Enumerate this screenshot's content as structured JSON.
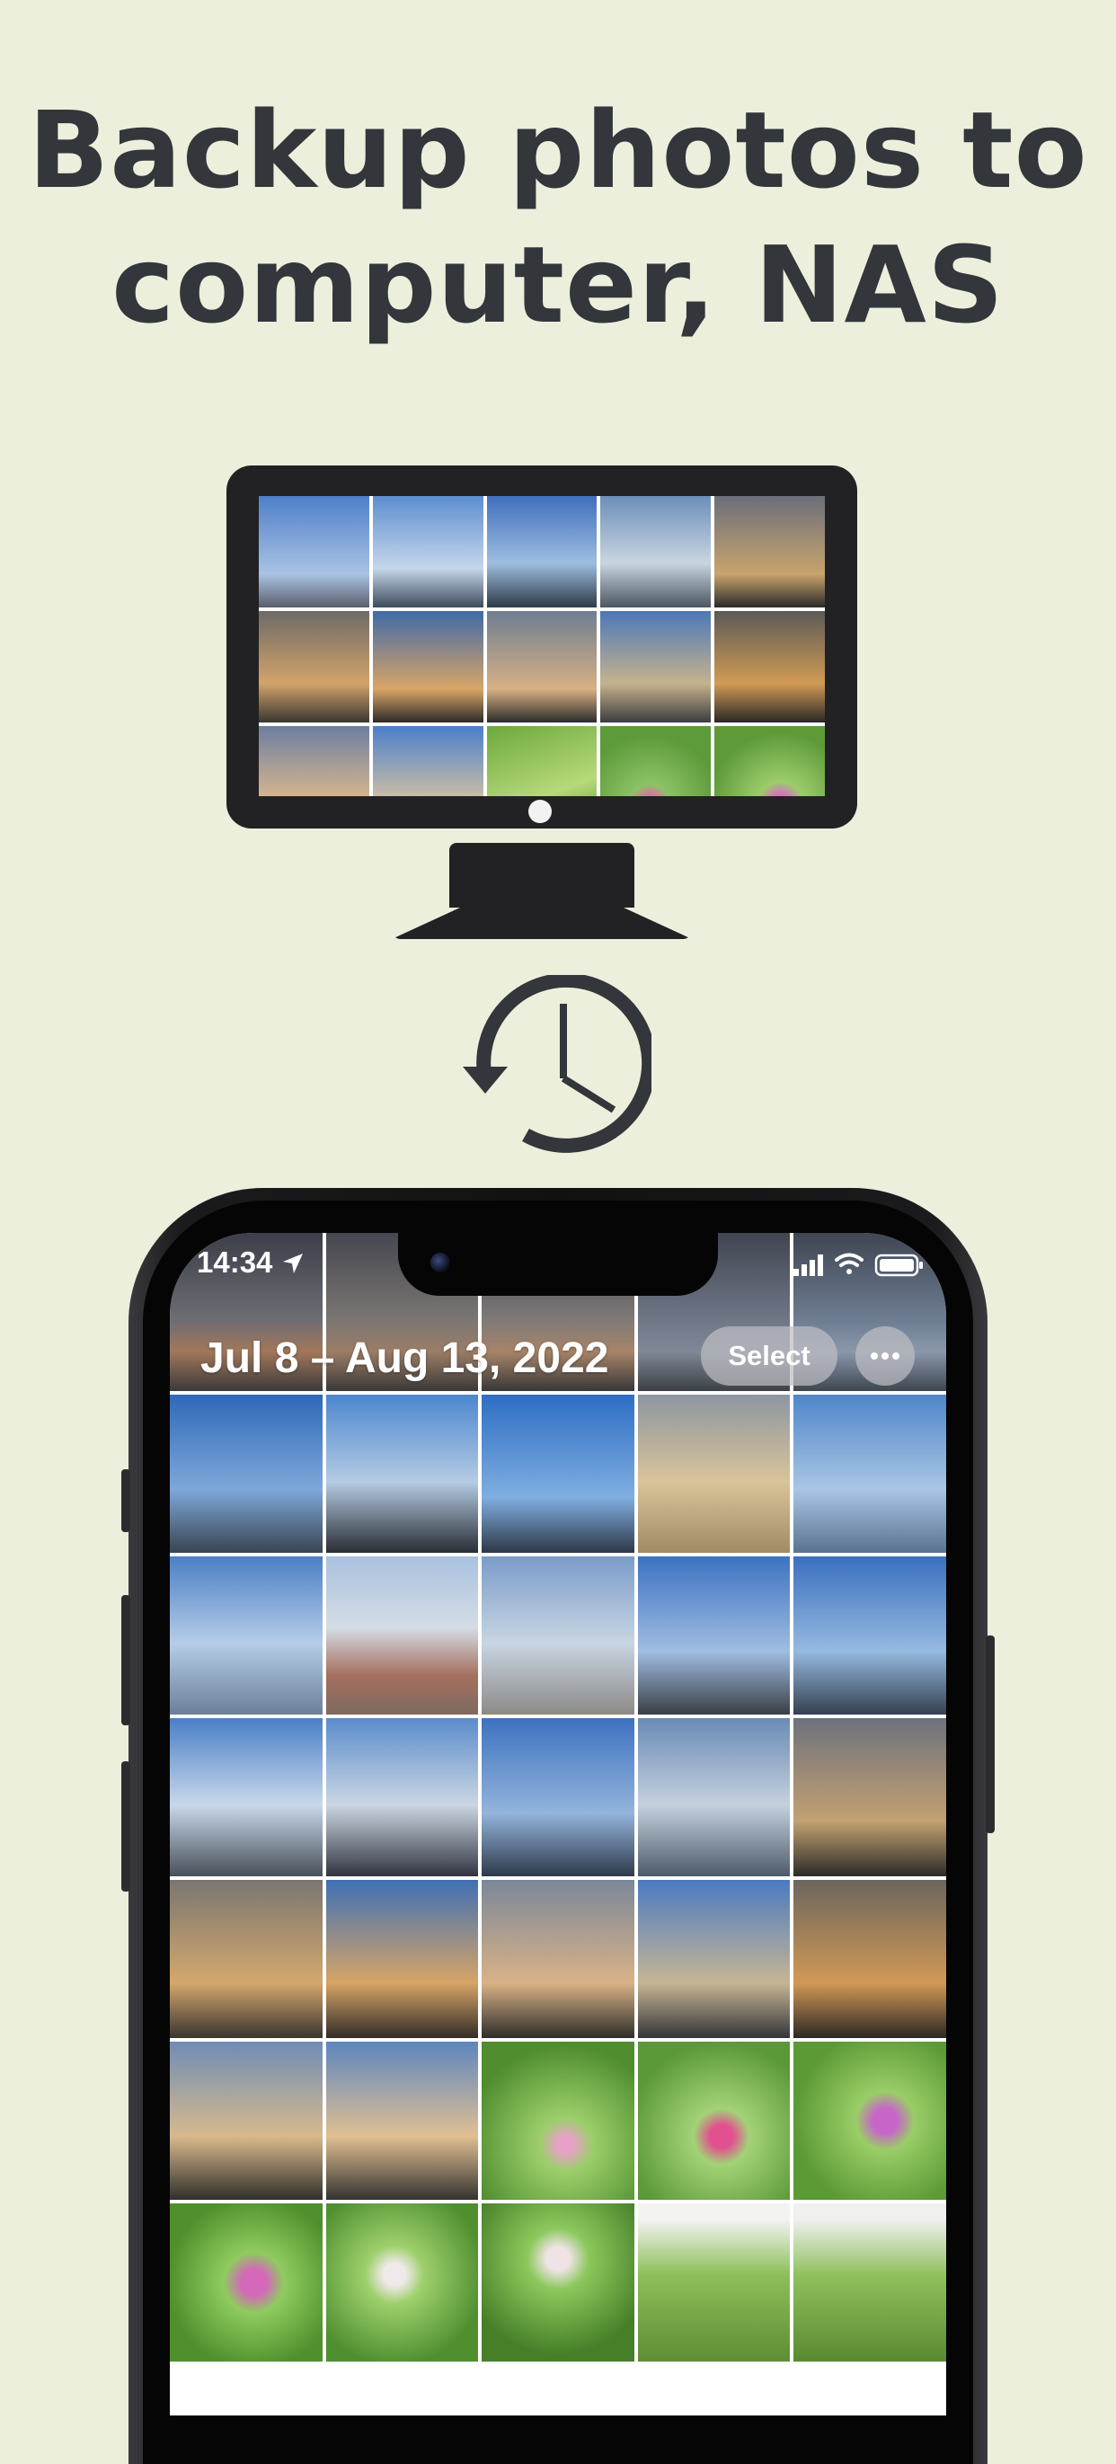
{
  "headline": {
    "line1": "Backup photos to",
    "line2": "computer, NAS"
  },
  "illustration": {
    "monitor_icon": "monitor-icon",
    "history_icon": "history-clock-icon"
  },
  "phone": {
    "status_bar": {
      "time": "14:34",
      "icons": [
        "location-arrow-icon",
        "cellular-signal-icon",
        "wifi-icon",
        "battery-icon"
      ]
    },
    "photos_header": {
      "date_range": "Jul 8 – Aug 13, 2022",
      "select_label": "Select",
      "more_icon": "ellipsis-icon"
    }
  },
  "colors": {
    "background": "#ecefdc",
    "headline_text": "#33363a",
    "device_body": "#222224"
  }
}
